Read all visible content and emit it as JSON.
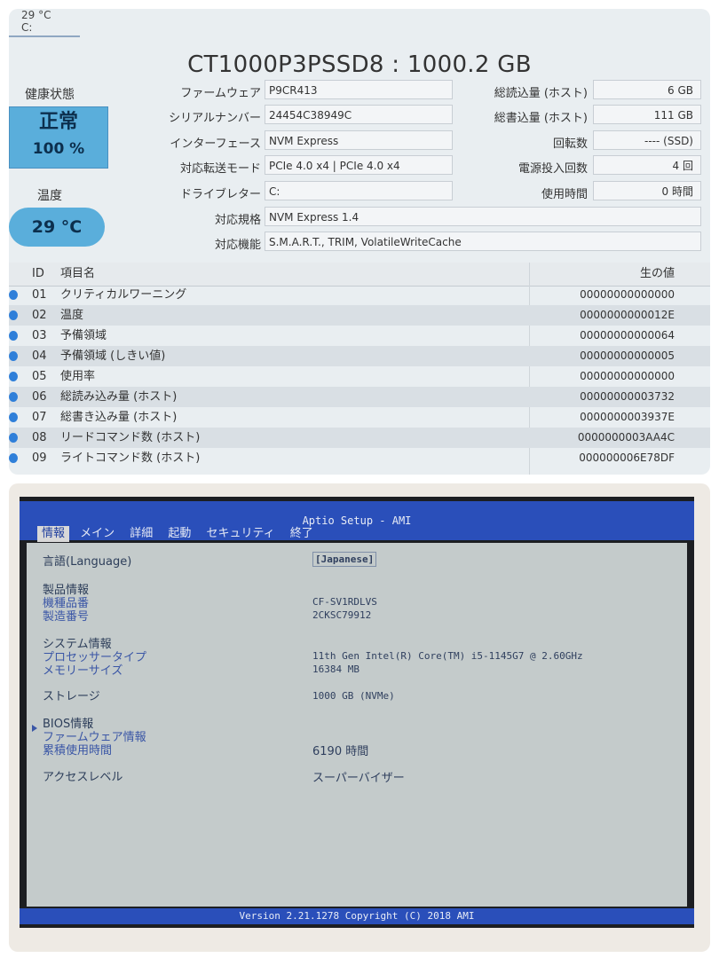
{
  "crystaldisk": {
    "temp_tab": {
      "temp": "29 °C",
      "drive": "C:"
    },
    "title": "CT1000P3PSSD8 : 1000.2 GB",
    "health_label": "健康状態",
    "health_status": "正常",
    "health_percent": "100 %",
    "temp_label": "温度",
    "temp_value": "29 °C",
    "info": [
      {
        "label": "ファームウェア",
        "value": "P9CR413"
      },
      {
        "label": "シリアルナンバー",
        "value": "24454C38949C"
      },
      {
        "label": "インターフェース",
        "value": "NVM Express"
      },
      {
        "label": "対応転送モード",
        "value": "PCIe 4.0 x4 | PCIe 4.0 x4"
      },
      {
        "label": "ドライブレター",
        "value": "C:"
      },
      {
        "label": "対応規格",
        "value": "NVM Express 1.4"
      },
      {
        "label": "対応機能",
        "value": "S.M.A.R.T., TRIM, VolatileWriteCache"
      }
    ],
    "stats": [
      {
        "label": "総読込量 (ホスト)",
        "value": "6 GB"
      },
      {
        "label": "総書込量 (ホスト)",
        "value": "111 GB"
      },
      {
        "label": "回転数",
        "value": "---- (SSD)"
      },
      {
        "label": "電源投入回数",
        "value": "4 回"
      },
      {
        "label": "使用時間",
        "value": "0 時間"
      }
    ],
    "table": {
      "headers": {
        "id": "ID",
        "name": "項目名",
        "raw": "生の値"
      },
      "rows": [
        {
          "id": "01",
          "name": "クリティカルワーニング",
          "raw": "00000000000000"
        },
        {
          "id": "02",
          "name": "温度",
          "raw": "0000000000012E"
        },
        {
          "id": "03",
          "name": "予備領域",
          "raw": "00000000000064"
        },
        {
          "id": "04",
          "name": "予備領域 (しきい値)",
          "raw": "00000000000005"
        },
        {
          "id": "05",
          "name": "使用率",
          "raw": "00000000000000"
        },
        {
          "id": "06",
          "name": "総読み込み量 (ホスト)",
          "raw": "00000000003732"
        },
        {
          "id": "07",
          "name": "総書き込み量 (ホスト)",
          "raw": "0000000003937E"
        },
        {
          "id": "08",
          "name": "リードコマンド数 (ホスト)",
          "raw": "0000000003AA4C"
        },
        {
          "id": "09",
          "name": "ライトコマンド数 (ホスト)",
          "raw": "000000006E78DF"
        }
      ]
    },
    "colors": {
      "health_blue": "#5aaedb",
      "status_dot": "#2f7fd9"
    }
  },
  "bios": {
    "title": "Aptio Setup - AMI",
    "tabs": [
      "情報",
      "メイン",
      "詳細",
      "起動",
      "セキュリティ",
      "終了"
    ],
    "active_tab": "情報",
    "language": {
      "label": "言語(Language)",
      "value": "[Japanese]"
    },
    "product": {
      "heading": "製品情報",
      "model_label": "機種品番",
      "model_value": "CF-SV1RDLVS",
      "serial_label": "製造番号",
      "serial_value": "2CKSC79912"
    },
    "system": {
      "heading": "システム情報",
      "cpu_label": "プロセッサータイプ",
      "cpu_value": "11th Gen Intel(R) Core(TM) i5-1145G7 @ 2.60GHz",
      "mem_label": "メモリーサイズ",
      "mem_value": "16384 MB",
      "storage_label": "ストレージ",
      "storage_value": "1000 GB (NVMe)"
    },
    "bios_info": {
      "heading": "BIOS情報",
      "firmware_label": "ファームウェア情報",
      "hours_label": "累積使用時間",
      "hours_value": "6190 時間"
    },
    "access": {
      "label": "アクセスレベル",
      "value": "スーパーバイザー"
    },
    "footer": "Version 2.21.1278 Copyright (C) 2018 AMI",
    "colors": {
      "bar": "#2a4fba",
      "body": "#c4cbcb"
    }
  }
}
